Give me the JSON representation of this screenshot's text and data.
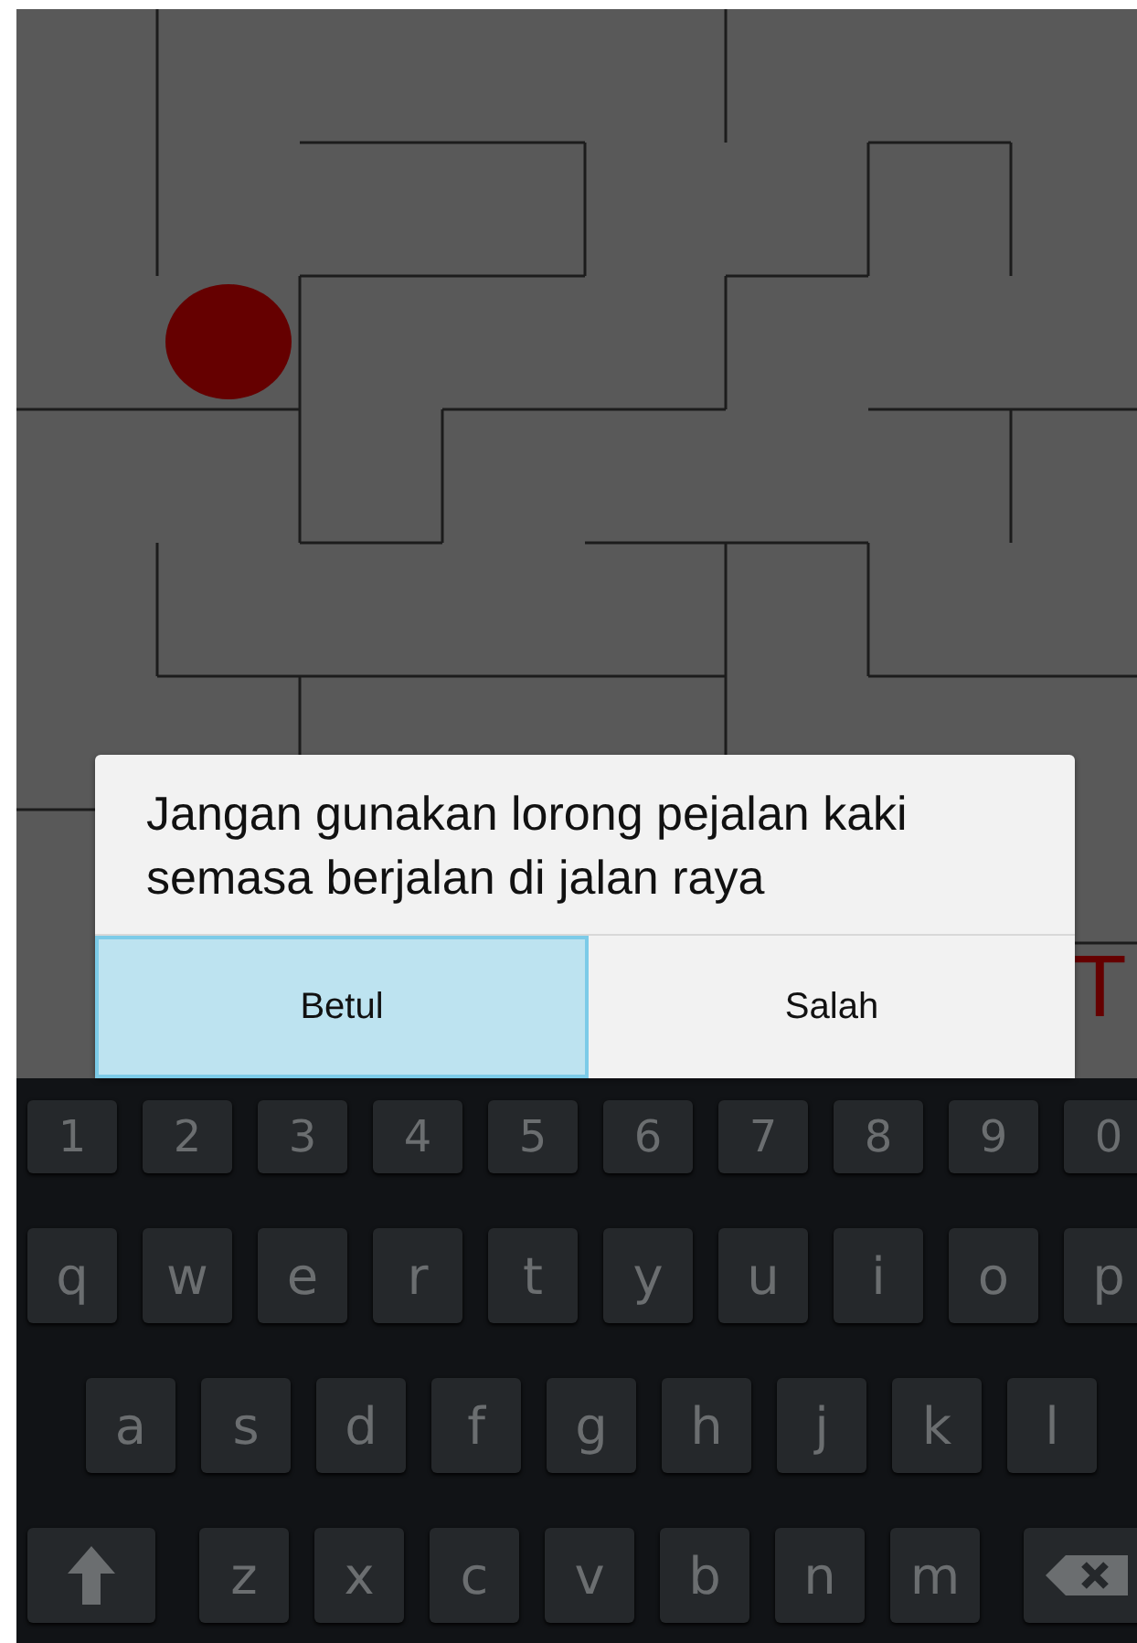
{
  "game": {
    "partial_letter": "T"
  },
  "dialog": {
    "message": "Jangan gunakan lorong pejalan kaki semasa berjalan di jalan raya",
    "buttons": [
      {
        "label": "Betul",
        "selected": true
      },
      {
        "label": "Salah",
        "selected": false
      }
    ]
  },
  "keyboard": {
    "rows": [
      [
        {
          "kind": "char",
          "label": "1"
        },
        {
          "kind": "char",
          "label": "2"
        },
        {
          "kind": "char",
          "label": "3"
        },
        {
          "kind": "char",
          "label": "4"
        },
        {
          "kind": "char",
          "label": "5"
        },
        {
          "kind": "char",
          "label": "6"
        },
        {
          "kind": "char",
          "label": "7"
        },
        {
          "kind": "char",
          "label": "8"
        },
        {
          "kind": "char",
          "label": "9"
        },
        {
          "kind": "char",
          "label": "0"
        }
      ],
      [
        {
          "kind": "char",
          "label": "q"
        },
        {
          "kind": "char",
          "label": "w"
        },
        {
          "kind": "char",
          "label": "e"
        },
        {
          "kind": "char",
          "label": "r"
        },
        {
          "kind": "char",
          "label": "t"
        },
        {
          "kind": "char",
          "label": "y"
        },
        {
          "kind": "char",
          "label": "u"
        },
        {
          "kind": "char",
          "label": "i"
        },
        {
          "kind": "char",
          "label": "o"
        },
        {
          "kind": "char",
          "label": "p"
        }
      ],
      [
        {
          "kind": "char",
          "label": "a"
        },
        {
          "kind": "char",
          "label": "s"
        },
        {
          "kind": "char",
          "label": "d"
        },
        {
          "kind": "char",
          "label": "f"
        },
        {
          "kind": "char",
          "label": "g"
        },
        {
          "kind": "char",
          "label": "h"
        },
        {
          "kind": "char",
          "label": "j"
        },
        {
          "kind": "char",
          "label": "k"
        },
        {
          "kind": "char",
          "label": "l"
        }
      ],
      [
        {
          "kind": "shift"
        },
        {
          "kind": "char",
          "label": "z"
        },
        {
          "kind": "char",
          "label": "x"
        },
        {
          "kind": "char",
          "label": "c"
        },
        {
          "kind": "char",
          "label": "v"
        },
        {
          "kind": "char",
          "label": "b"
        },
        {
          "kind": "char",
          "label": "n"
        },
        {
          "kind": "char",
          "label": "m"
        },
        {
          "kind": "backspace"
        }
      ]
    ]
  }
}
